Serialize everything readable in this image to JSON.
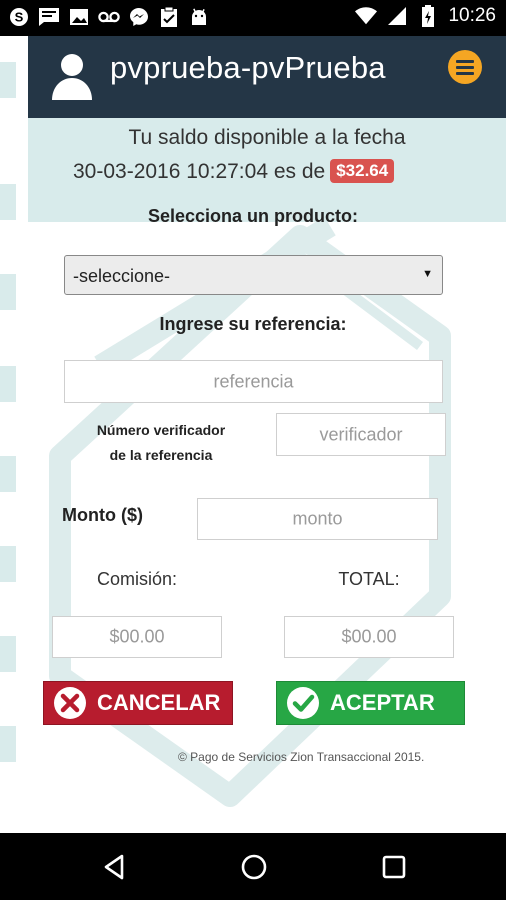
{
  "status_bar": {
    "time": "10:26",
    "left_icons": [
      "skype-icon",
      "message-icon",
      "image-icon",
      "voicemail-icon",
      "messenger-icon",
      "clipboard-icon",
      "android-icon"
    ],
    "right_icons": [
      "wifi-icon",
      "signal-icon",
      "battery-icon"
    ]
  },
  "header": {
    "title": "pvprueba-pvPrueba",
    "bg_color": "#243646",
    "menu_color": "#f5a623"
  },
  "balance": {
    "line1": "Tu saldo disponible a la fecha",
    "line2": "30-03-2016 10:27:04 es de",
    "amount": "$32.64",
    "amount_color": "#d9534f"
  },
  "form": {
    "product_label": "Selecciona un producto:",
    "product_select": "-seleccione-",
    "reference_label": "Ingrese su referencia:",
    "reference_placeholder": "referencia",
    "verifier_label_line1": "Número verificador",
    "verifier_label_line2": "de la referencia",
    "verifier_placeholder": "verificador",
    "amount_label": "Monto ($)",
    "amount_placeholder": "monto",
    "commission_label": "Comisión:",
    "commission_value": "$00.00",
    "total_label": "TOTAL:",
    "total_value": "$00.00"
  },
  "buttons": {
    "cancel": "CANCELAR",
    "accept": "ACEPTAR",
    "cancel_color": "#b71c2e",
    "accept_color": "#27a745"
  },
  "footer": {
    "text": "© Pago de Servicios Zion Transaccional 2015."
  },
  "nav_bar": {
    "buttons": [
      "back-icon",
      "home-icon",
      "recents-icon"
    ]
  }
}
